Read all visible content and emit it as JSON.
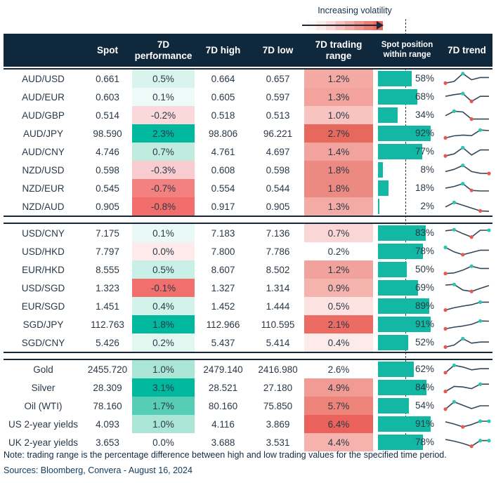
{
  "legend": {
    "label": "Increasing volatility"
  },
  "colors": {
    "header_bg": "#10283c",
    "header_text": "#ffffff",
    "row_text": "#2a3848",
    "bar_teal": "#12b8a3",
    "strong_teal": "#00b89d",
    "strong_red": "#f1706e",
    "spark_line": "#33475b",
    "dot_red": "#e8584c",
    "dot_teal": "#2cc5b0",
    "separator": "#16293b"
  },
  "chart_data": {
    "type": "table",
    "columns": [
      "",
      "Spot",
      "7D performance",
      "7D high",
      "7D low",
      "7D trading range",
      "Spot position within range",
      "7D trend"
    ],
    "sections": [
      {
        "rows": [
          {
            "name": "AUD/USD",
            "spot": "0.661",
            "perf": "0.5%",
            "perf_bg": "#d8f4ec",
            "high": "0.664",
            "low": "0.657",
            "range": "1.2%",
            "range_bg": "#f4a9a3",
            "position_pct": "58%",
            "position_value": 58,
            "spark": [
              0.1,
              0.25,
              0.95,
              0.4,
              0.6,
              0.6
            ],
            "dots": [
              {
                "i": 0,
                "c": "red"
              },
              {
                "i": 2,
                "c": "teal"
              }
            ]
          },
          {
            "name": "AUD/EUR",
            "spot": "0.603",
            "perf": "0.1%",
            "perf_bg": "#eefaf7",
            "high": "0.605",
            "low": "0.597",
            "range": "1.3%",
            "range_bg": "#f3a29c",
            "position_pct": "68%",
            "position_value": 68,
            "spark": [
              0.55,
              0.7,
              0.8,
              0.1,
              0.55,
              0.55
            ],
            "dots": [
              {
                "i": 2,
                "c": "teal"
              },
              {
                "i": 3,
                "c": "red"
              }
            ]
          },
          {
            "name": "AUD/GBP",
            "spot": "0.514",
            "perf": "-0.2%",
            "perf_bg": "#fbd9db",
            "high": "0.518",
            "low": "0.513",
            "range": "1.0%",
            "range_bg": "#f7c4c0",
            "position_pct": "34%",
            "position_value": 34,
            "spark": [
              0.45,
              0.85,
              0.78,
              0.15,
              0.15,
              0.15
            ],
            "dots": [
              {
                "i": 1,
                "c": "teal"
              },
              {
                "i": 3,
                "c": "red"
              }
            ]
          },
          {
            "name": "AUD/JPY",
            "spot": "98.590",
            "perf": "2.3%",
            "perf_bg": "#00b89d",
            "high": "98.806",
            "low": "96.221",
            "range": "2.7%",
            "range_bg": "#e7695e",
            "position_pct": "92%",
            "position_value": 92,
            "spark": [
              0.1,
              0.28,
              0.35,
              0.3,
              0.8,
              0.75
            ],
            "dots": [
              {
                "i": 0,
                "c": "red"
              },
              {
                "i": 4,
                "c": "teal"
              }
            ]
          },
          {
            "name": "AUD/CNY",
            "spot": "4.746",
            "perf": "0.7%",
            "perf_bg": "#c0ecdf",
            "high": "4.761",
            "low": "4.697",
            "range": "1.4%",
            "range_bg": "#f2a39d",
            "position_pct": "77%",
            "position_value": 77,
            "spark": [
              0.12,
              0.3,
              0.85,
              0.2,
              0.65,
              0.65
            ],
            "dots": [
              {
                "i": 0,
                "c": "red"
              },
              {
                "i": 2,
                "c": "teal"
              }
            ]
          },
          {
            "name": "NZD/USD",
            "spot": "0.598",
            "perf": "-0.3%",
            "perf_bg": "#f9cdcf",
            "high": "0.608",
            "low": "0.598",
            "range": "1.8%",
            "range_bg": "#ec8a81",
            "position_pct": "8%",
            "position_value": 8,
            "spark": [
              0.35,
              0.55,
              0.9,
              0.35,
              0.2,
              0.18
            ],
            "dots": [
              {
                "i": 2,
                "c": "teal"
              },
              {
                "i": 5,
                "c": "red"
              }
            ]
          },
          {
            "name": "NZD/EUR",
            "spot": "0.545",
            "perf": "-0.7%",
            "perf_bg": "#f3817f",
            "high": "0.554",
            "low": "0.544",
            "range": "1.8%",
            "range_bg": "#ec8a81",
            "position_pct": "18%",
            "position_value": 18,
            "spark": [
              0.5,
              0.65,
              0.9,
              0.3,
              0.25,
              0.25
            ],
            "dots": [
              {
                "i": 2,
                "c": "teal"
              },
              {
                "i": 3,
                "c": "red"
              }
            ]
          },
          {
            "name": "NZD/AUD",
            "spot": "0.905",
            "perf": "-0.8%",
            "perf_bg": "#f16e6c",
            "high": "0.917",
            "low": "0.905",
            "range": "1.3%",
            "range_bg": "#f4aaa5",
            "position_pct": "2%",
            "position_value": 2,
            "spark": [
              0.45,
              0.85,
              0.6,
              0.35,
              0.1,
              0.07
            ],
            "dots": [
              {
                "i": 1,
                "c": "teal"
              },
              {
                "i": 4,
                "c": "red"
              }
            ]
          }
        ]
      },
      {
        "rows": [
          {
            "name": "USD/CNY",
            "spot": "7.175",
            "perf": "0.1%",
            "perf_bg": "#e9f9f5",
            "high": "7.183",
            "low": "7.136",
            "range": "0.7%",
            "range_bg": "#fad6d4",
            "position_pct": "83%",
            "position_value": 83,
            "spark": [
              0.7,
              0.8,
              0.45,
              0.15,
              0.75,
              0.75
            ],
            "dots": [
              {
                "i": 1,
                "c": "teal"
              },
              {
                "i": 3,
                "c": "red"
              },
              {
                "i": 5,
                "c": "teal"
              }
            ]
          },
          {
            "name": "USD/HKD",
            "spot": "7.797",
            "perf": "0.0%",
            "perf_bg": "#fdeaea",
            "high": "7.800",
            "low": "7.786",
            "range": "0.2%",
            "range_bg": "#ffffff",
            "position_pct": "78%",
            "position_value": 78,
            "spark": [
              0.85,
              0.45,
              0.2,
              0.4,
              0.6,
              0.6
            ],
            "dots": [
              {
                "i": 0,
                "c": "teal"
              },
              {
                "i": 2,
                "c": "red"
              }
            ]
          },
          {
            "name": "EUR/HKD",
            "spot": "8.555",
            "perf": "0.5%",
            "perf_bg": "#c8f0e6",
            "high": "8.607",
            "low": "8.502",
            "range": "1.2%",
            "range_bg": "#f2a29c",
            "position_pct": "50%",
            "position_value": 50,
            "spark": [
              0.15,
              0.2,
              0.45,
              0.8,
              0.6,
              0.6
            ],
            "dots": [
              {
                "i": 0,
                "c": "red"
              },
              {
                "i": 3,
                "c": "teal"
              }
            ]
          },
          {
            "name": "USD/SGD",
            "spot": "1.323",
            "perf": "-0.1%",
            "perf_bg": "#f1706e",
            "high": "1.327",
            "low": "1.314",
            "range": "0.9%",
            "range_bg": "#f5b3ae",
            "position_pct": "69%",
            "position_value": 69,
            "spark": [
              0.75,
              0.8,
              0.3,
              0.18,
              0.45,
              0.7
            ],
            "dots": [
              {
                "i": 1,
                "c": "teal"
              },
              {
                "i": 3,
                "c": "red"
              }
            ]
          },
          {
            "name": "EUR/SGD",
            "spot": "1.451",
            "perf": "0.4%",
            "perf_bg": "#d3f2e9",
            "high": "1.452",
            "low": "1.444",
            "range": "0.5%",
            "range_bg": "#fce3e1",
            "position_pct": "89%",
            "position_value": 89,
            "spark": [
              0.15,
              0.35,
              0.5,
              0.62,
              0.85,
              0.85
            ],
            "dots": [
              {
                "i": 0,
                "c": "red"
              },
              {
                "i": 4,
                "c": "teal"
              }
            ]
          },
          {
            "name": "SGD/JPY",
            "spot": "112.763",
            "perf": "1.8%",
            "perf_bg": "#00b89d",
            "high": "112.966",
            "low": "110.595",
            "range": "2.1%",
            "range_bg": "#ec6c64",
            "position_pct": "91%",
            "position_value": 91,
            "spark": [
              0.1,
              0.25,
              0.35,
              0.5,
              0.8,
              0.78
            ],
            "dots": [
              {
                "i": 0,
                "c": "red"
              },
              {
                "i": 4,
                "c": "teal"
              }
            ]
          },
          {
            "name": "SGD/CNY",
            "spot": "5.426",
            "perf": "0.2%",
            "perf_bg": "#e3f7f1",
            "high": "5.437",
            "low": "5.414",
            "range": "0.4%",
            "range_bg": "#fcebe9",
            "position_pct": "52%",
            "position_value": 52,
            "spark": [
              0.1,
              0.28,
              0.85,
              0.45,
              0.55,
              0.55
            ],
            "dots": [
              {
                "i": 0,
                "c": "red"
              },
              {
                "i": 2,
                "c": "teal"
              }
            ]
          }
        ]
      },
      {
        "rows": [
          {
            "name": "Gold",
            "spot": "2455.720",
            "perf": "1.0%",
            "perf_bg": "#abe5d6",
            "high": "2479.140",
            "low": "2416.980",
            "range": "2.6%",
            "range_bg": "#ffffff",
            "position_pct": "62%",
            "position_value": 62,
            "spark": [
              0.2,
              0.85,
              0.7,
              0.45,
              0.55,
              0.55
            ],
            "dots": [
              {
                "i": 0,
                "c": "red"
              },
              {
                "i": 1,
                "c": "teal"
              }
            ]
          },
          {
            "name": "Silver",
            "spot": "28.309",
            "perf": "3.1%",
            "perf_bg": "#00b89d",
            "high": "28.521",
            "low": "27.180",
            "range": "4.9%",
            "range_bg": "#f19b94",
            "position_pct": "84%",
            "position_value": 84,
            "spark": [
              0.15,
              0.6,
              0.55,
              0.4,
              0.8,
              0.8
            ],
            "dots": [
              {
                "i": 0,
                "c": "red"
              },
              {
                "i": 4,
                "c": "teal"
              }
            ]
          },
          {
            "name": "Oil (WTI)",
            "spot": "78.160",
            "perf": "1.7%",
            "perf_bg": "#56cdb6",
            "high": "80.160",
            "low": "75.850",
            "range": "5.7%",
            "range_bg": "#ee8379",
            "position_pct": "54%",
            "position_value": 54,
            "spark": [
              0.2,
              0.85,
              0.55,
              0.25,
              0.5,
              0.5
            ],
            "dots": [
              {
                "i": 0,
                "c": "red"
              },
              {
                "i": 1,
                "c": "teal"
              }
            ]
          },
          {
            "name": "US 2-year yields",
            "spot": "4.093",
            "perf": "1.0%",
            "perf_bg": "#abe5d6",
            "high": "4.116",
            "low": "3.869",
            "range": "6.4%",
            "range_bg": "#ea625b",
            "position_pct": "91%",
            "position_value": 91,
            "spark": [
              0.7,
              0.5,
              0.25,
              0.45,
              0.75,
              0.75
            ],
            "dots": [
              {
                "i": 2,
                "c": "red"
              },
              {
                "i": 4,
                "c": "teal"
              },
              {
                "i": 5,
                "c": "teal"
              }
            ]
          },
          {
            "name": "UK 2-year yields",
            "spot": "3.653",
            "perf": "0.0%",
            "perf_bg": "#ffffff",
            "high": "3.688",
            "low": "3.531",
            "range": "4.4%",
            "range_bg": "#f6b3ae",
            "position_pct": "78%",
            "position_value": 78,
            "spark": [
              0.75,
              0.6,
              0.4,
              0.15,
              0.65,
              0.65
            ],
            "dots": [
              {
                "i": 3,
                "c": "red"
              },
              {
                "i": 4,
                "c": "teal"
              },
              {
                "i": 5,
                "c": "teal"
              }
            ]
          }
        ]
      }
    ]
  },
  "footer": {
    "note": "Note: trading range is the percentage difference between high and low trading values for the specified time period.",
    "sources": "Sources: Bloomberg, Convera - August 16, 2024"
  }
}
